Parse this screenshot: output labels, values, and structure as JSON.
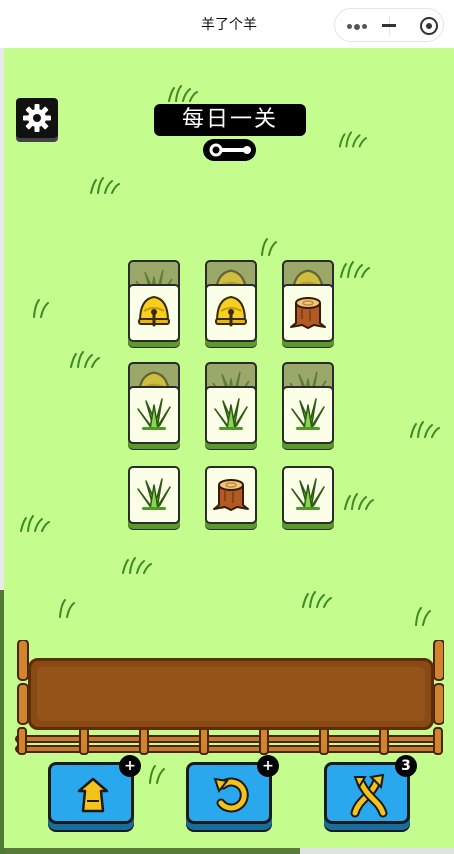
{
  "window": {
    "title": "羊了个羊"
  },
  "titlebar_icons": [
    "more-dots-icon",
    "minimize-icon",
    "close-target-icon"
  ],
  "header": {
    "level_title": "每日一关",
    "settings_icon": "gear-icon",
    "key_icon": "key-icon"
  },
  "board": {
    "rows": [
      {
        "back": [
          "grass",
          "bell",
          "bell"
        ],
        "front": [
          "bell",
          "bell",
          "stump"
        ]
      },
      {
        "back": [
          "bell",
          "grass",
          "grass"
        ],
        "front": [
          "grass",
          "grass",
          "grass"
        ]
      },
      {
        "back": [],
        "front": [
          "grass",
          "stump",
          "grass"
        ]
      }
    ]
  },
  "tray": {
    "slots": 7,
    "items": []
  },
  "tools": [
    {
      "name": "move-out",
      "icon": "move-out-icon",
      "badge": "+"
    },
    {
      "name": "undo",
      "icon": "undo-icon",
      "badge": "+"
    },
    {
      "name": "shuffle",
      "icon": "shuffle-icon",
      "badge": "3"
    }
  ],
  "colors": {
    "background": "#c4fc8e",
    "tool_blue": "#2aa8ee",
    "tray_brown": "#8a4a14",
    "tile_face": "#fbffe8"
  }
}
